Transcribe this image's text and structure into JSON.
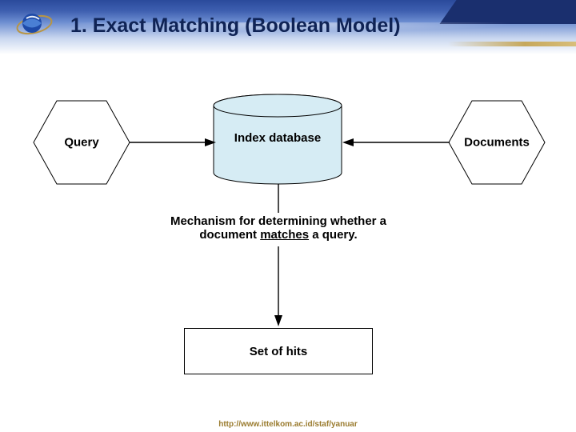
{
  "slide": {
    "title": "1.  Exact Matching (Boolean Model)",
    "footer_url": "http://www.ittelkom.ac.id/staf/yanuar"
  },
  "nodes": {
    "query_label": "Query",
    "documents_label": "Documents",
    "index_label": "Index database",
    "hits_label": "Set of hits"
  },
  "mechanism": {
    "line1_pre": "Mechanism for determining whether a",
    "line2_pre": "document ",
    "line2_match": "matches",
    "line2_post": " a query."
  },
  "colors": {
    "band_dark": "#2a4a9b",
    "cylinder_fill": "#d6ecf4",
    "accent_gold": "#c6a85b"
  }
}
